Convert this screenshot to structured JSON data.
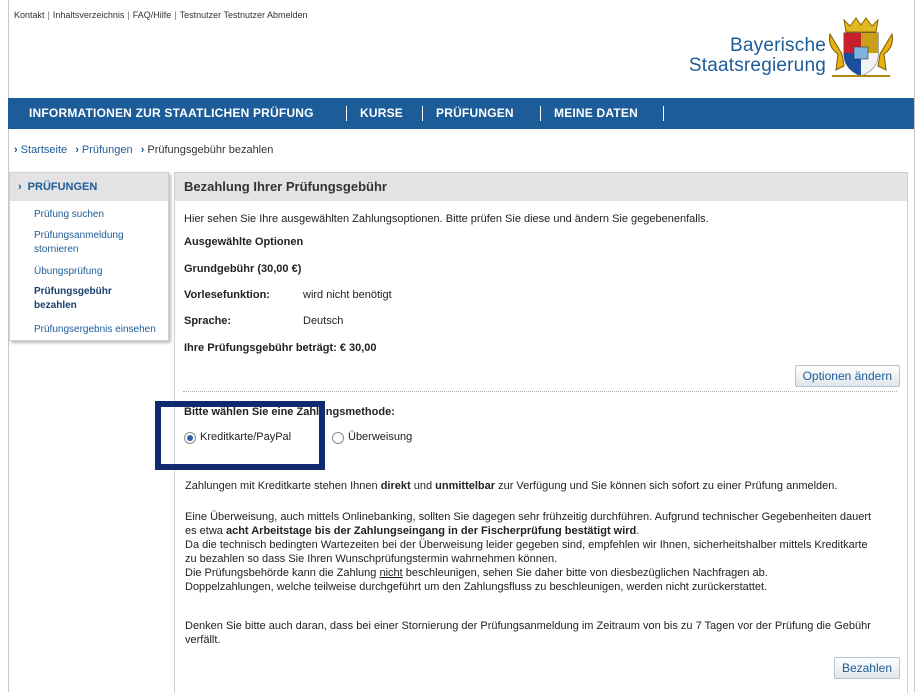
{
  "top_links": {
    "kontakt": "Kontakt",
    "inhaltsverzeichnis": "Inhaltsverzeichnis",
    "faq": "FAQ/Hilfe",
    "user": "Testnutzer Testnutzer",
    "logout": "Abmelden",
    "separator": "|"
  },
  "brand": {
    "line1": "Bayerische",
    "line2": "Staatsregierung",
    "color": "#1c5c98"
  },
  "nav": {
    "items": [
      "INFORMATIONEN ZUR STAATLICHEN PRÜFUNG",
      "KURSE",
      "PRÜFUNGEN",
      "MEINE DATEN"
    ],
    "background": "#1c5c98"
  },
  "breadcrumb": {
    "home": "Startseite",
    "section": "Prüfungen",
    "current": "Prüfungsgebühr bezahlen"
  },
  "sidebar": {
    "header": "PRÜFUNGEN",
    "items": [
      {
        "label": "Prüfung suchen",
        "active": false
      },
      {
        "label": "Prüfungsanmeldung stornieren",
        "active": false
      },
      {
        "label": "Übungsprüfung",
        "active": false
      },
      {
        "label": "Prüfungsgebühr bezahlen",
        "active": true
      },
      {
        "label": "Prüfungsergebnis einsehen",
        "active": false
      }
    ]
  },
  "panel": {
    "title": "Bezahlung Ihrer Prüfungsgebühr",
    "intro": "Hier sehen Sie Ihre ausgewählten Zahlungsoptionen. Bitte prüfen Sie diese und ändern Sie gegebenenfalls.",
    "selected_heading": "Ausgewählte Optionen",
    "base_fee": "Grundgebühr (30,00 €)",
    "options": [
      {
        "label": "Vorlesefunktion:",
        "value": "wird nicht benötigt"
      },
      {
        "label": "Sprache:",
        "value": "Deutsch"
      }
    ],
    "total": "Ihre Prüfungsgebühr beträgt: € 30,00",
    "change_button": "Optionen ändern",
    "method_heading": "Bitte wählen Sie eine Zahlungsmethode:",
    "methods": [
      {
        "label": "Kreditkarte/PayPal",
        "checked": true
      },
      {
        "label": "Überweisung",
        "checked": false
      }
    ],
    "info_p1": {
      "a": "Zahlungen mit Kreditkarte stehen Ihnen ",
      "b": "direkt",
      "c": " und ",
      "d": "unmittelbar",
      "e": " zur Verfügung und Sie können sich sofort zu einer Prüfung anmelden."
    },
    "info_p2": {
      "l1": "Eine Überweisung, auch mittels Onlinebanking, sollten Sie dagegen sehr frühzeitig durchführen. Aufgrund technischer Gegebenheiten dauert",
      "l2a": "es etwa ",
      "l2b": "acht Arbeitstage bis der Zahlungseingang in der Fischerprüfung bestätigt wird",
      "l2c": ".",
      "l3": "Da die technisch bedingten Wartezeiten bei der Überweisung leider gegeben sind, empfehlen wir Ihnen, sicherheitshalber mittels Kreditkarte",
      "l4": "zu bezahlen so dass Sie Ihren Wunschprüfungstermin wahrnehmen können.",
      "l5a": "Die Prüfungsbehörde kann die Zahlung ",
      "l5b": "nicht",
      "l5c": " beschleunigen, sehen Sie daher bitte von diesbezüglichen Nachfragen ab.",
      "l6": "Doppelzahlungen, welche teilweise durchgeführt um den Zahlungsfluss zu beschleunigen, werden nicht zurückerstattet."
    },
    "info_p3": {
      "l1": "Denken Sie bitte auch daran, dass bei einer Stornierung der Prüfungsanmeldung im Zeitraum von bis zu 7 Tagen vor der Prüfung die Gebühr",
      "l2": "verfällt."
    },
    "pay_button": "Bezahlen"
  }
}
